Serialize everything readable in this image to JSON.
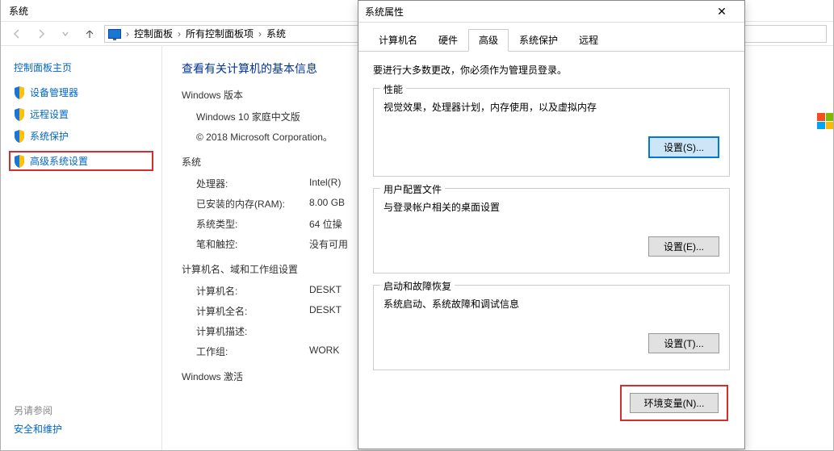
{
  "window": {
    "title": "系统",
    "breadcrumb": [
      "控制面板",
      "所有控制面板项",
      "系统"
    ]
  },
  "sidebar": {
    "home_label": "控制面板主页",
    "items": [
      {
        "label": "设备管理器"
      },
      {
        "label": "远程设置"
      },
      {
        "label": "系统保护"
      },
      {
        "label": "高级系统设置"
      }
    ],
    "see_also_label": "另请参阅",
    "see_also_items": [
      {
        "label": "安全和维护"
      }
    ]
  },
  "content": {
    "heading": "查看有关计算机的基本信息",
    "windows_edition_title": "Windows 版本",
    "edition": "Windows 10 家庭中文版",
    "copyright": "© 2018 Microsoft Corporation。",
    "system_title": "系统",
    "rows": {
      "processor_label": "处理器:",
      "processor_value": "Intel(R)",
      "ram_label": "已安装的内存(RAM):",
      "ram_value": "8.00 GB",
      "type_label": "系统类型:",
      "type_value": "64 位操",
      "pen_label": "笔和触控:",
      "pen_value": "没有可用"
    },
    "domain_title": "计算机名、域和工作组设置",
    "domain_rows": {
      "name_label": "计算机名:",
      "name_value": "DESKT",
      "fullname_label": "计算机全名:",
      "fullname_value": "DESKT",
      "desc_label": "计算机描述:",
      "desc_value": "",
      "workgroup_label": "工作组:",
      "workgroup_value": "WORK"
    },
    "activation_title": "Windows 激活"
  },
  "dialog": {
    "title": "系统属性",
    "tabs": [
      "计算机名",
      "硬件",
      "高级",
      "系统保护",
      "远程"
    ],
    "active_tab": "高级",
    "admin_note": "要进行大多数更改，你必须作为管理员登录。",
    "groups": {
      "performance": {
        "title": "性能",
        "desc": "视觉效果，处理器计划，内存使用，以及虚拟内存",
        "button": "设置(S)..."
      },
      "user_profile": {
        "title": "用户配置文件",
        "desc": "与登录帐户相关的桌面设置",
        "button": "设置(E)..."
      },
      "startup": {
        "title": "启动和故障恢复",
        "desc": "系统启动、系统故障和调试信息",
        "button": "设置(T)..."
      }
    },
    "env_button": "环境变量(N)..."
  }
}
